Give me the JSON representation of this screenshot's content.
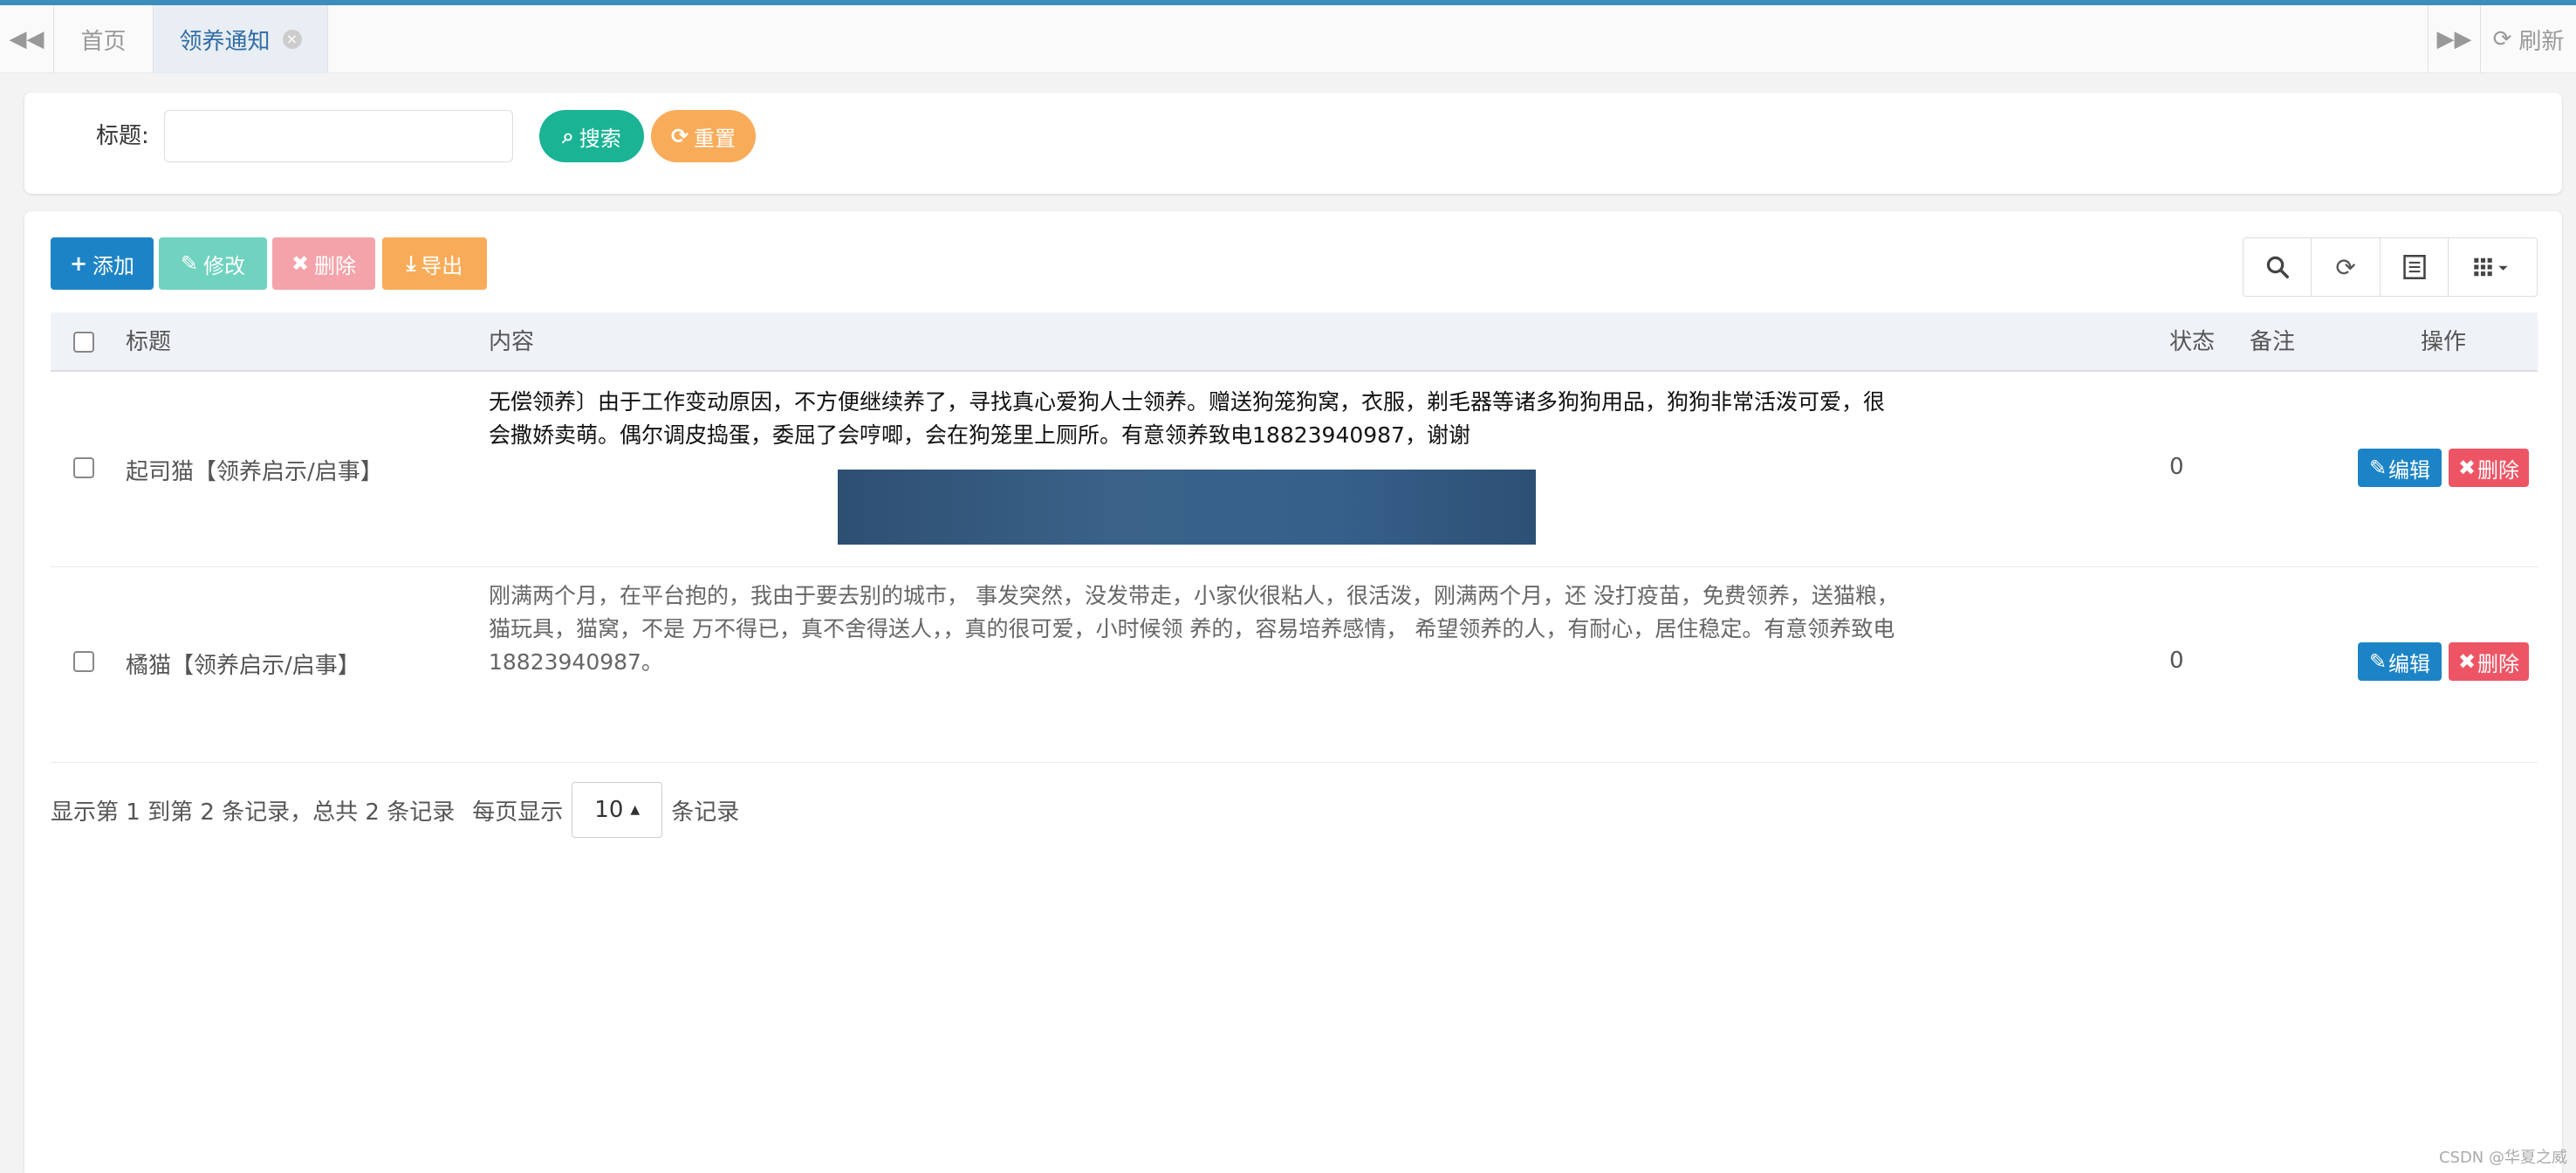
{
  "tabs": {
    "home": "首页",
    "active": "领养通知",
    "refresh": "刷新"
  },
  "search": {
    "label": "标题:",
    "placeholder": "",
    "search_btn": "搜索",
    "reset_btn": "重置"
  },
  "toolbar": {
    "add": "添加",
    "edit": "修改",
    "delete": "删除",
    "export": "导出"
  },
  "table": {
    "headers": {
      "title": "标题",
      "content": "内容",
      "status": "状态",
      "remark": "备注",
      "actions": "操作"
    },
    "rows": [
      {
        "title": "起司猫【领养启示/启事】",
        "content": "无偿领养〕由于工作变动原因，不方便继续养了，寻找真心爱狗人士领养。赠送狗笼狗窝，衣服，剃毛器等诸多狗狗用品，狗狗非常活泼可爱，很会撒娇卖萌。偶尔调皮捣蛋，委屈了会哼唧，会在狗笼里上厕所。有意领养致电18823940987，谢谢",
        "status": "0",
        "remark": "",
        "edit": "编辑",
        "delete": "删除"
      },
      {
        "title": "橘猫【领养启示/启事】",
        "content": "刚满两个月，在平台抱的，我由于要去别的城市， 事发突然，没发带走，小家伙很粘人，很活泼，刚满两个月，还 没打疫苗，免费领养，送猫粮，猫玩具，猫窝，不是 万不得已，真不舍得送人，，真的很可爱，小时候领 养的，容易培养感情， 希望领养的人，有耐心，居住稳定。有意领养致电18823940987。",
        "status": "0",
        "remark": "",
        "edit": "编辑",
        "delete": "删除"
      }
    ]
  },
  "pagination": {
    "summary": "显示第 1 到第 2 条记录，总共 2 条记录",
    "per_page_prefix": "每页显示",
    "per_page": "10",
    "per_page_suffix": "条记录"
  },
  "watermark": "CSDN @华夏之威"
}
